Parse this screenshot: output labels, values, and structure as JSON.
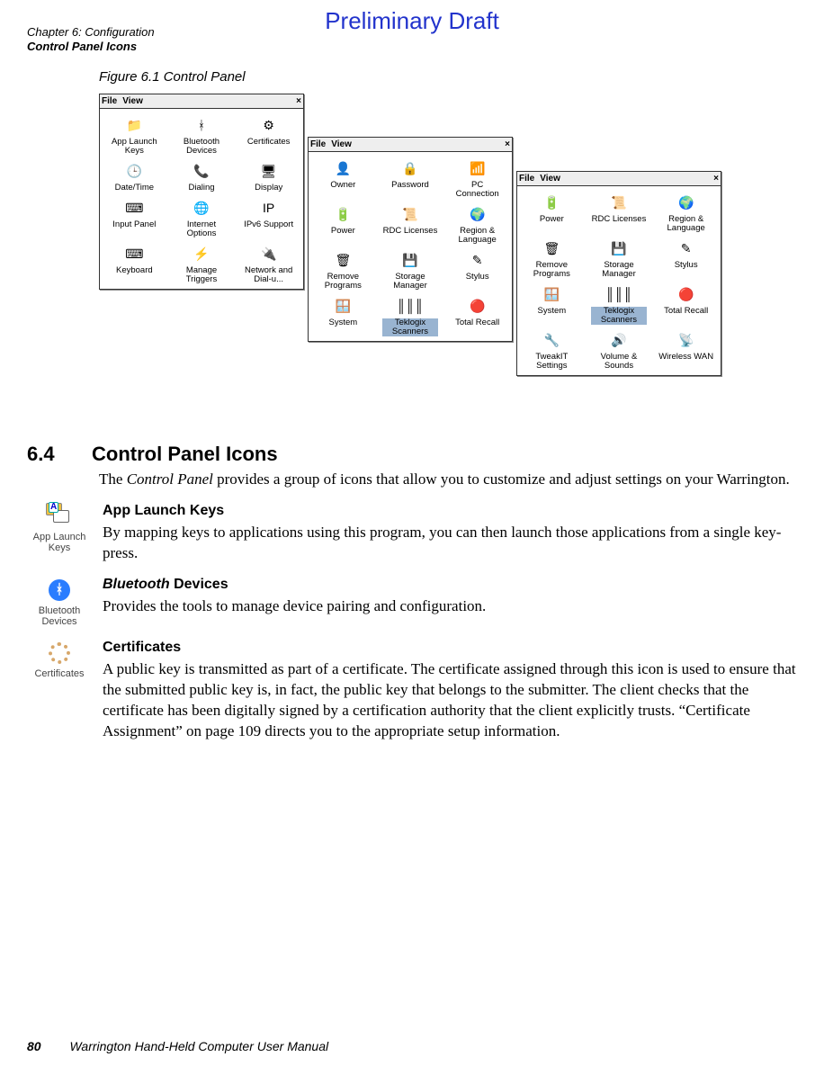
{
  "watermark": "Preliminary Draft",
  "header": {
    "line1": "Chapter 6: Configuration",
    "line2": "Control Panel Icons"
  },
  "figure_caption": "Figure 6.1  Control Panel",
  "panels": {
    "menu_file": "File",
    "menu_view": "View",
    "close": "×",
    "p1": [
      {
        "label": "App Launch Keys",
        "icon": "📁"
      },
      {
        "label": "Bluetooth Devices",
        "icon": "ᚼ"
      },
      {
        "label": "Certificates",
        "icon": "⚙"
      },
      {
        "label": "Date/Time",
        "icon": "🕒"
      },
      {
        "label": "Dialing",
        "icon": "📞"
      },
      {
        "label": "Display",
        "icon": "🖥"
      },
      {
        "label": "Input Panel",
        "icon": "⌨"
      },
      {
        "label": "Internet Options",
        "icon": "🌐"
      },
      {
        "label": "IPv6 Support",
        "icon": "IP"
      },
      {
        "label": "Keyboard",
        "icon": "⌨"
      },
      {
        "label": "Manage Triggers",
        "icon": "⚡"
      },
      {
        "label": "Network and Dial-u...",
        "icon": "🔌"
      }
    ],
    "p2": [
      {
        "label": "Owner",
        "icon": "👤"
      },
      {
        "label": "Password",
        "icon": "🔒"
      },
      {
        "label": "PC Connection",
        "icon": "📶"
      },
      {
        "label": "Power",
        "icon": "🔋"
      },
      {
        "label": "RDC Licenses",
        "icon": "📜"
      },
      {
        "label": "Region & Language",
        "icon": "🌍"
      },
      {
        "label": "Remove Programs",
        "icon": "🗑"
      },
      {
        "label": "Storage Manager",
        "icon": "💾"
      },
      {
        "label": "Stylus",
        "icon": "✎"
      },
      {
        "label": "System",
        "icon": "🪟"
      },
      {
        "label": "Teklogix Scanners",
        "icon": "║║║",
        "selected": true
      },
      {
        "label": "Total Recall",
        "icon": "🔴"
      }
    ],
    "p3": [
      {
        "label": "Power",
        "icon": "🔋"
      },
      {
        "label": "RDC Licenses",
        "icon": "📜"
      },
      {
        "label": "Region & Language",
        "icon": "🌍"
      },
      {
        "label": "Remove Programs",
        "icon": "🗑"
      },
      {
        "label": "Storage Manager",
        "icon": "💾"
      },
      {
        "label": "Stylus",
        "icon": "✎"
      },
      {
        "label": "System",
        "icon": "🪟"
      },
      {
        "label": "Teklogix Scanners",
        "icon": "║║║",
        "selected": true
      },
      {
        "label": "Total Recall",
        "icon": "🔴"
      },
      {
        "label": "TweakIT Settings",
        "icon": "🔧"
      },
      {
        "label": "Volume & Sounds",
        "icon": "🔊"
      },
      {
        "label": "Wireless WAN",
        "icon": "📡"
      }
    ]
  },
  "section": {
    "number": "6.4",
    "title": "Control Panel Icons",
    "intro_prefix": "The ",
    "intro_italic": "Control Panel",
    "intro_suffix": " provides a group of icons that allow you to customize and adjust settings on your Warrington."
  },
  "subsections": [
    {
      "icon_label": "App Launch Keys",
      "heading": "App Launch Keys",
      "heading_italic": "",
      "text": "By mapping keys to applications using this program, you can then launch those applications from a single key-press."
    },
    {
      "icon_label": "Bluetooth Devices",
      "heading_italic": "Bluetooth",
      "heading": " Devices",
      "text": "Provides the tools to manage device pairing and configuration."
    },
    {
      "icon_label": "Certificates",
      "heading": "Certificates",
      "heading_italic": "",
      "text": "A public key is transmitted as part of a certificate. The certificate assigned through this icon is used to ensure that the submitted public key is, in fact, the public key that belongs to the submitter. The client checks that the certificate has been digitally signed by a certification authority that the client explicitly trusts. “Certificate Assignment” on page 109 directs you to the appropriate setup information."
    }
  ],
  "footer": {
    "page": "80",
    "title": "Warrington Hand-Held Computer User Manual"
  }
}
